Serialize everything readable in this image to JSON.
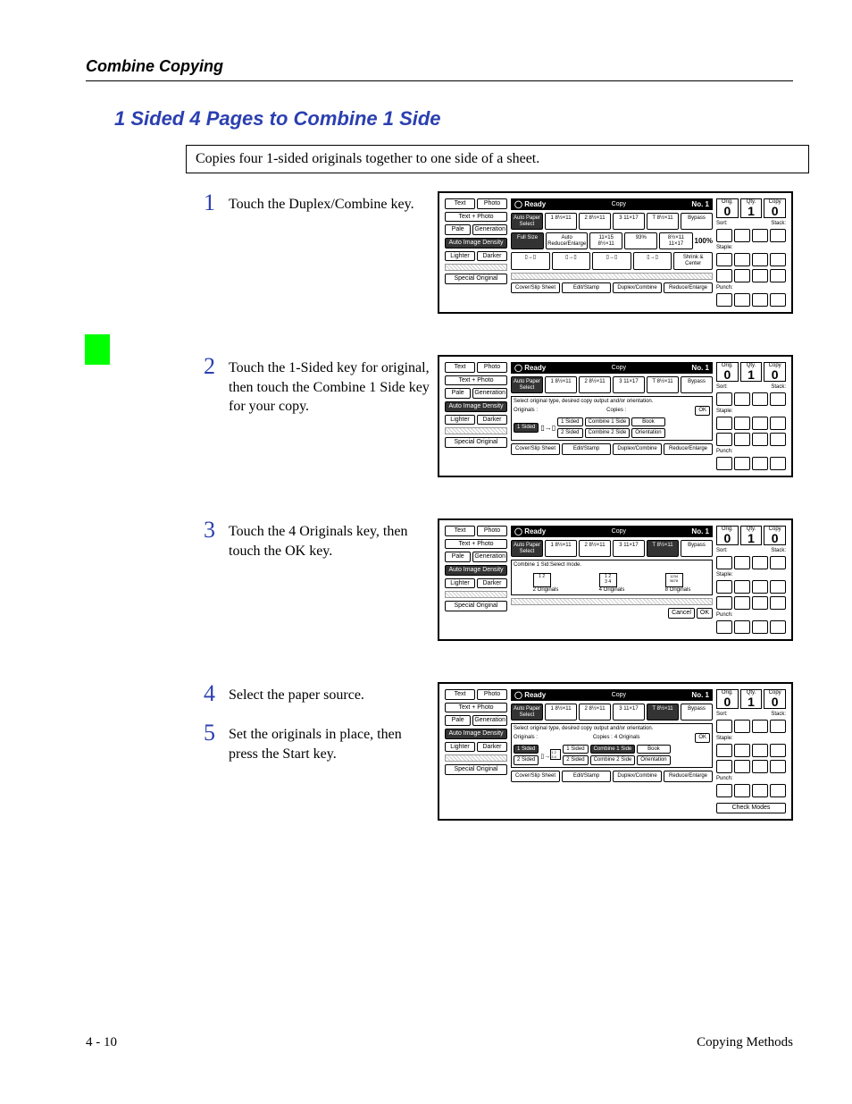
{
  "header": {
    "title": "Combine Copying"
  },
  "section_title": "1 Sided 4 Pages to Combine 1 Side",
  "intro": "Copies four 1-sided originals together to one side of a sheet.",
  "steps": [
    {
      "num": "1",
      "text": "Touch the Duplex/Combine key."
    },
    {
      "num": "2",
      "text": "Touch the 1-Sided key for original, then touch the Combine 1 Side key for your copy."
    },
    {
      "num": "3",
      "text": "Touch the 4 Originals key, then touch the OK key."
    },
    {
      "num": "4",
      "text": "Select the paper source."
    },
    {
      "num": "5",
      "text": "Set the originals in place, then press the Start key."
    }
  ],
  "footer": {
    "left": "4 - 10",
    "right": "Copying Methods"
  },
  "screen_common": {
    "left_col": {
      "top_pair": [
        "Text",
        "Photo"
      ],
      "textphoto": "Text + Photo",
      "bottom_pair": [
        "Pale",
        "Generation"
      ],
      "density": "Auto Image Density",
      "lighter_darker": [
        "Lighter",
        "Darker"
      ],
      "special": "Special Original"
    },
    "status": {
      "ready": "Ready",
      "mode": "Copy",
      "no": "No. 1"
    },
    "paper_select": "Auto Paper Select",
    "trays": [
      "1 8½×11",
      "2 8½×11",
      "3 11×17",
      "T 8½×11",
      "Bypass"
    ],
    "tabs": [
      "Cover/Slip Sheet",
      "Edit/Stamp",
      "Duplex/Combine",
      "Reduce/Enlarge"
    ],
    "counters": {
      "orig": "Orig.",
      "qty": "Qty.",
      "copy": "Copy",
      "v_orig": "0",
      "v_qty": "1",
      "v_copy": "0"
    },
    "right_labels": [
      "Sort:",
      "Stack:",
      "Staple:",
      "Punch:"
    ]
  },
  "screen1": {
    "ratio_row": {
      "full": "Full Size",
      "auto": "Auto Reduce/Enlarge",
      "a": "11×15 8½×11",
      "pct": "93%",
      "b": "8½×11 11×17",
      "hundred": "100%"
    },
    "shrink": "Shrink & Center"
  },
  "screen2": {
    "prompt": "Select original type, desired copy output and/or orientation.",
    "originals_lbl": "Originals :",
    "copies_lbl": "Copies :",
    "orig_btn": "1 Sided",
    "copy_btns_col1": [
      "1 Sided",
      "2 Sided"
    ],
    "copy_btns_col2": [
      "Combine 1 Side",
      "Combine 2 Side"
    ],
    "right_btns": [
      "OK",
      "Book",
      "Orientation"
    ]
  },
  "screen3": {
    "prompt": "Combine 1 Sid:Select mode.",
    "options": [
      "2 Originals",
      "4 Originals",
      "8 Originals"
    ],
    "cancel": "Cancel",
    "ok": "OK"
  },
  "screen4": {
    "prompt": "Select original type, desired copy output and/or orientation.",
    "originals_lbl": "Originals :",
    "copies_lbl": "Copies :",
    "copies_val": "4 Originals",
    "orig_btns": [
      "1 Sided",
      "2 Sided"
    ],
    "copy_btns_col1": [
      "1 Sided",
      "2 Sided"
    ],
    "copy_btns_col2": [
      "Combine 1 Side",
      "Combine 2 Side"
    ],
    "right_btns": [
      "OK",
      "Book",
      "Orientation"
    ],
    "check": "Check Modes"
  }
}
